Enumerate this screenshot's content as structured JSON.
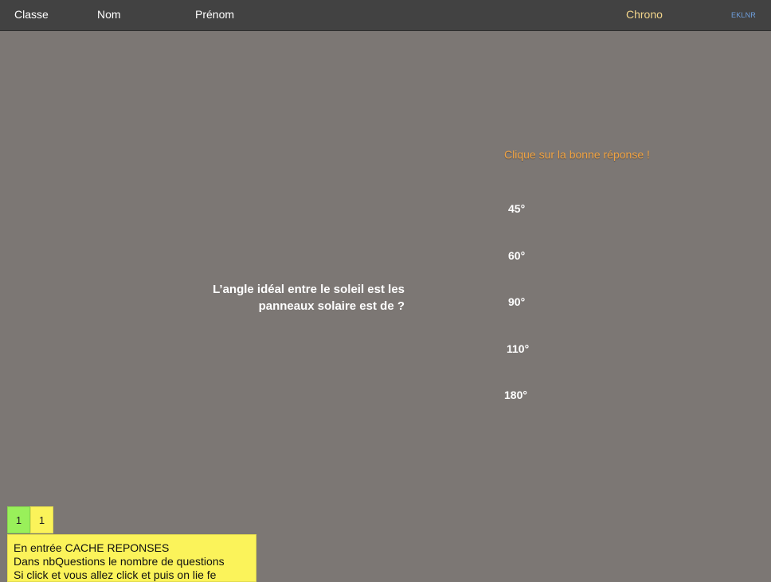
{
  "header": {
    "classe": "Classe",
    "nom": "Nom",
    "prenom": "Prénom",
    "chrono": "Chrono",
    "brand": "EKLNR"
  },
  "instruction": "Clique sur la bonne réponse !",
  "question": {
    "line1": "L’angle idéal entre le soleil est les",
    "line2": "panneaux solaire est de ?"
  },
  "answers": [
    "45°",
    "60°",
    "90°",
    "110°",
    "180°"
  ],
  "score": {
    "left_value": "1",
    "right_value": "1"
  },
  "info": {
    "lines": [
      "En entrée CACHE REPONSES",
      "Dans nbQuestions le nombre de questions",
      "Si click et vous allez click et puis on lie fe"
    ]
  },
  "colors": {
    "background": "#7c7774",
    "topbar": "#424242",
    "instruction": "#f0a343",
    "chrono": "#f2d58b",
    "brand": "#6fa0df",
    "score_green": "#99f05a",
    "score_yellow": "#fbf35a"
  }
}
